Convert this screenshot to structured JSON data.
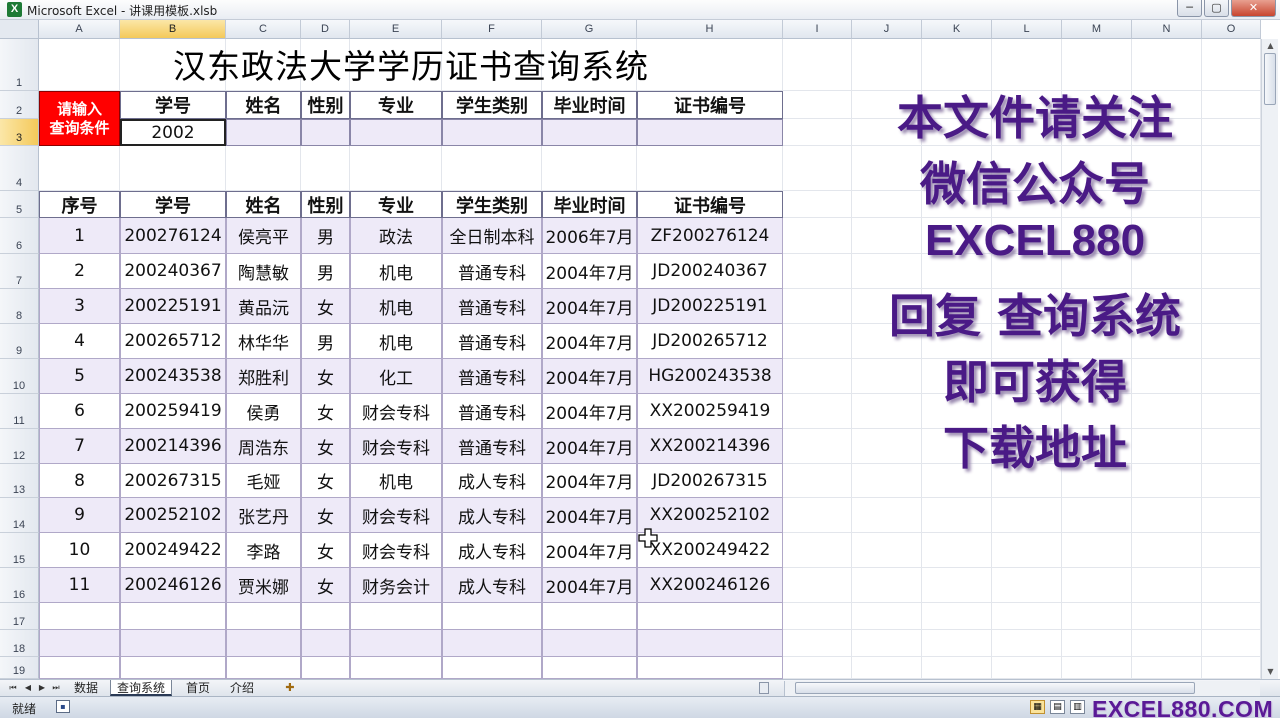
{
  "window": {
    "title": "Microsoft Excel - 讲课用模板.xlsb",
    "app_icon": "X",
    "minimize": "─",
    "maximize": "▢",
    "close": "✕"
  },
  "columns": [
    "A",
    "B",
    "C",
    "D",
    "E",
    "F",
    "G",
    "H",
    "I",
    "J",
    "K",
    "L",
    "M",
    "N",
    "O"
  ],
  "rows": [
    "1",
    "2",
    "3",
    "4",
    "5",
    "6",
    "7",
    "8",
    "9",
    "10",
    "11",
    "12",
    "13",
    "14",
    "15",
    "16",
    "17",
    "18",
    "19"
  ],
  "sheet": {
    "title": "汉东政法大学学历证书查询系统",
    "query_label_line1": "请输入",
    "query_label_line2": "查询条件",
    "query_headers": [
      "学号",
      "姓名",
      "性别",
      "专业",
      "学生类别",
      "毕业时间",
      "证书编号"
    ],
    "query_values": [
      "2002",
      "",
      "",
      "",
      "",
      "",
      ""
    ],
    "table_headers": [
      "序号",
      "学号",
      "姓名",
      "性别",
      "专业",
      "学生类别",
      "毕业时间",
      "证书编号"
    ],
    "table_rows": [
      [
        "1",
        "200276124",
        "侯亮平",
        "男",
        "政法",
        "全日制本科",
        "2006年7月",
        "ZF200276124"
      ],
      [
        "2",
        "200240367",
        "陶慧敏",
        "男",
        "机电",
        "普通专科",
        "2004年7月",
        "JD200240367"
      ],
      [
        "3",
        "200225191",
        "黄品沅",
        "女",
        "机电",
        "普通专科",
        "2004年7月",
        "JD200225191"
      ],
      [
        "4",
        "200265712",
        "林华华",
        "男",
        "机电",
        "普通专科",
        "2004年7月",
        "JD200265712"
      ],
      [
        "5",
        "200243538",
        "郑胜利",
        "女",
        "化工",
        "普通专科",
        "2004年7月",
        "HG200243538"
      ],
      [
        "6",
        "200259419",
        "侯勇",
        "女",
        "财会专科",
        "普通专科",
        "2004年7月",
        "XX200259419"
      ],
      [
        "7",
        "200214396",
        "周浩东",
        "女",
        "财会专科",
        "普通专科",
        "2004年7月",
        "XX200214396"
      ],
      [
        "8",
        "200267315",
        "毛娅",
        "女",
        "机电",
        "成人专科",
        "2004年7月",
        "JD200267315"
      ],
      [
        "9",
        "200252102",
        "张艺丹",
        "女",
        "财会专科",
        "成人专科",
        "2004年7月",
        "XX200252102"
      ],
      [
        "10",
        "200249422",
        "李路",
        "女",
        "财会专科",
        "成人专科",
        "2004年7月",
        "XX200249422"
      ],
      [
        "11",
        "200246126",
        "贾米娜",
        "女",
        "财务会计",
        "成人专科",
        "2004年7月",
        "XX200246126"
      ],
      [
        "",
        "",
        "",
        "",
        "",
        "",
        "",
        ""
      ],
      [
        "",
        "",
        "",
        "",
        "",
        "",
        "",
        ""
      ],
      [
        "",
        "",
        "",
        "",
        "",
        "",
        "",
        ""
      ]
    ]
  },
  "promo": {
    "line1": "本文件请关注",
    "line2": "微信公众号",
    "line3": "EXCEL880",
    "line4": "回复 查询系统",
    "line5": "即可获得",
    "line6": "下载地址"
  },
  "tabs": {
    "nav_first": "⏮",
    "nav_prev": "◀",
    "nav_next": "▶",
    "nav_last": "⏭",
    "items": [
      "数据",
      "查询系统",
      "首页",
      "介绍"
    ],
    "active": "查询系统",
    "new_sheet": "✚"
  },
  "status": {
    "ready": "就绪",
    "watermark": "EXCEL880.COM"
  },
  "colors": {
    "accent_purple": "#4a1a86",
    "query_red": "#ff0000",
    "row_band": "#eeeaf8"
  }
}
